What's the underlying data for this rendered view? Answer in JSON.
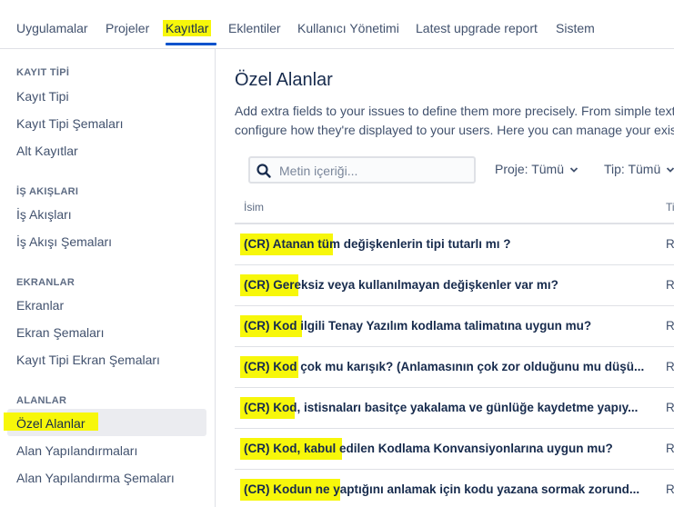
{
  "topnav": {
    "tabs": [
      "Uygulamalar",
      "Projeler",
      "Kayıtlar",
      "Eklentiler",
      "Kullanıcı Yönetimi",
      "Latest upgrade report",
      "Sistem"
    ],
    "active": "Kayıtlar"
  },
  "sidebar": {
    "sections": [
      {
        "heading": "KAYIT TİPİ",
        "items": [
          "Kayıt Tipi",
          "Kayıt Tipi Şemaları",
          "Alt Kayıtlar"
        ]
      },
      {
        "heading": "İŞ AKIŞLARI",
        "items": [
          "İş Akışları",
          "İş Akışı Şemaları"
        ]
      },
      {
        "heading": "EKRANLAR",
        "items": [
          "Ekranlar",
          "Ekran Şemaları",
          "Kayıt Tipi Ekran Şemaları"
        ]
      },
      {
        "heading": "ALANLAR",
        "items": [
          "Özel Alanlar",
          "Alan Yapılandırmaları",
          "Alan Yapılandırma Şemaları"
        ]
      }
    ],
    "active_item": "Özel Alanlar"
  },
  "main": {
    "title": "Özel Alanlar",
    "description_line1": "Add extra fields to your issues to define them more precisely. From simple text",
    "description_line2": "configure how they're displayed to your users. Here you can manage your exis",
    "search": {
      "placeholder": "Metin içeriği..."
    },
    "filters": {
      "project": "Proje: Tümü",
      "type": "Tip: Tümü"
    },
    "columns": {
      "name": "İsim",
      "type": "Ti"
    },
    "rows": [
      {
        "name": "(CR) Atanan tüm değişkenlerin tipi tutarlı mı ?",
        "type": "R"
      },
      {
        "name": "(CR) Gereksiz veya kullanılmayan değişkenler var mı?",
        "type": "R"
      },
      {
        "name": "(CR) Kod ilgili Tenay Yazılım kodlama talimatına uygun mu?",
        "type": "R"
      },
      {
        "name": "(CR) Kod çok mu karışık? (Anlamasının çok zor olduğunu mu düşü...",
        "type": "R"
      },
      {
        "name": "(CR) Kod, istisnaları basitçe yakalama ve günlüğe kaydetme yapıy...",
        "type": "R"
      },
      {
        "name": "(CR) Kod, kabul edilen Kodlama Konvansiyonlarına uygun mu?",
        "type": "R"
      },
      {
        "name": "(CR) Kodun ne yaptığını anlamak için kodu yazana sormak zorund...",
        "type": "R"
      }
    ]
  },
  "colors": {
    "highlight": "#f7f70a",
    "accent": "#0052cc",
    "text": "#172b4d",
    "muted": "#42526e",
    "border": "#dfe1e6"
  },
  "icons": [
    "search-icon",
    "chevron-down-icon"
  ]
}
